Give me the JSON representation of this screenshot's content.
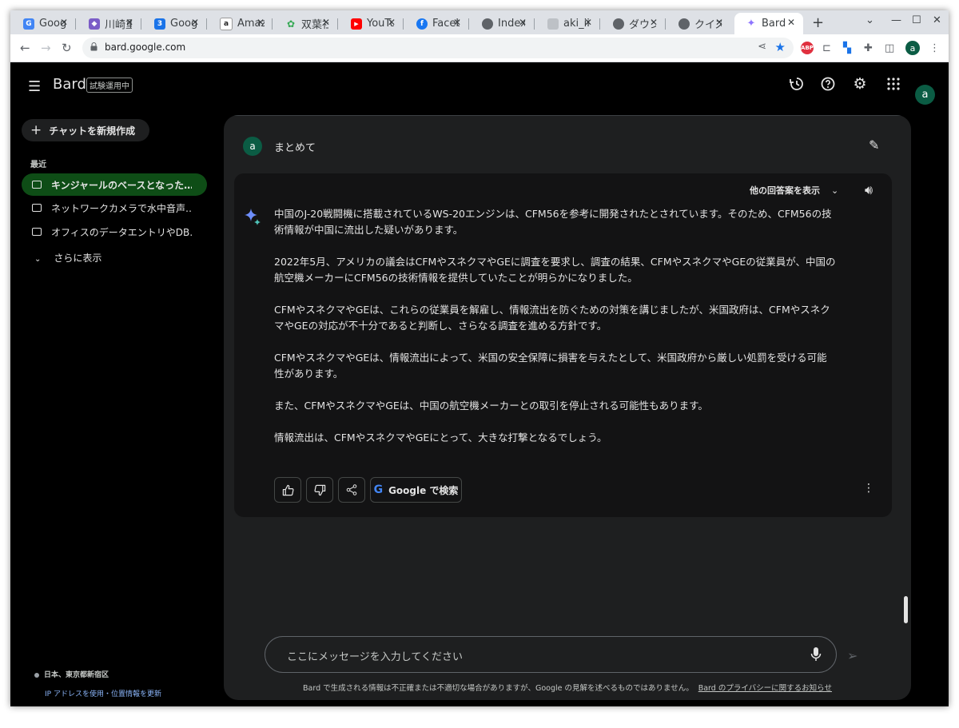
{
  "browser": {
    "tabs": [
      {
        "title": "Google",
        "favicon": "google-translate-icon",
        "color": "#4285f4"
      },
      {
        "title": "川崎重工",
        "favicon": "cube-icon",
        "color": "#7b5cc7"
      },
      {
        "title": "Google",
        "favicon": "google-calendar-icon",
        "color": "#1a73e8"
      },
      {
        "title": "Amazon",
        "favicon": "amazon-icon",
        "color": "#222222"
      },
      {
        "title": "双葉社",
        "favicon": "sprout-icon",
        "color": "#34a853"
      },
      {
        "title": "YouTube",
        "favicon": "youtube-icon",
        "color": "#ff0000"
      },
      {
        "title": "Facebook",
        "favicon": "facebook-icon",
        "color": "#1877f2"
      },
      {
        "title": "Index",
        "favicon": "globe-icon",
        "color": "#5f6368"
      },
      {
        "title": "aki_ii",
        "favicon": "image-icon",
        "color": "#bdc1c6"
      },
      {
        "title": "ダウン",
        "favicon": "globe-icon",
        "color": "#5f6368"
      },
      {
        "title": "クイズ",
        "favicon": "globe-icon",
        "color": "#5f6368"
      },
      {
        "title": "Bard",
        "favicon": "bard-spark-icon",
        "color": "#8e75ff"
      }
    ],
    "url": "bard.google.com",
    "profile_initial": "a",
    "abp_label": "ABP"
  },
  "bard": {
    "brand": "Bard",
    "beta_badge": "試験運用中",
    "avatar_initial": "a",
    "sidebar": {
      "new_chat": "チャットを新規作成",
      "recent_heading": "最近",
      "recent_items": [
        "キンジャールのベースとなった…",
        "ネットワークカメラで水中音声…",
        "オフィスのデータエントリやDB…"
      ],
      "show_more": "さらに表示",
      "location": "日本、東京都新宿区",
      "location_link": "IP アドレスを使用・位置情報を更新"
    },
    "chat": {
      "user_prompt": "まとめて",
      "drafts_label": "他の回答案を表示",
      "response_paragraphs": [
        [
          "中国のJ-20戦闘機に搭載されているWS-20エンジンは、CFM56を参考に開発されたとされています。そのため、CFM56の技",
          "術情報が中国に流出した疑いがあります。"
        ],
        [
          "2022年5月、アメリカの議会はCFMやスネクマやGEに調査を要求し、調査の結果、CFMやスネクマやGEの従業員が、中国の",
          "航空機メーカーにCFM56の技術情報を提供していたことが明らかになりました。"
        ],
        [
          "CFMやスネクマやGEは、これらの従業員を解雇し、情報流出を防ぐための対策を講じましたが、米国政府は、CFMやスネク",
          "マやGEの対応が不十分であると判断し、さらなる調査を進める方針です。"
        ],
        [
          "CFMやスネクマやGEは、情報流出によって、米国の安全保障に損害を与えたとして、米国政府から厳しい処罰を受ける可能",
          "性があります。"
        ],
        [
          "また、CFMやスネクマやGEは、中国の航空機メーカーとの取引を停止される可能性もあります。"
        ],
        [
          "情報流出は、CFMやスネクマやGEにとって、大きな打撃となるでしょう。"
        ]
      ],
      "google_search_label": "Google で検索",
      "input_placeholder": "ここにメッセージを入力してください",
      "disclaimer": "Bard で生成される情報は不正確または不適切な場合がありますが、Google の見解を述べるものではありません。",
      "privacy_link": "Bard のプライバシーに関するお知らせ"
    }
  }
}
